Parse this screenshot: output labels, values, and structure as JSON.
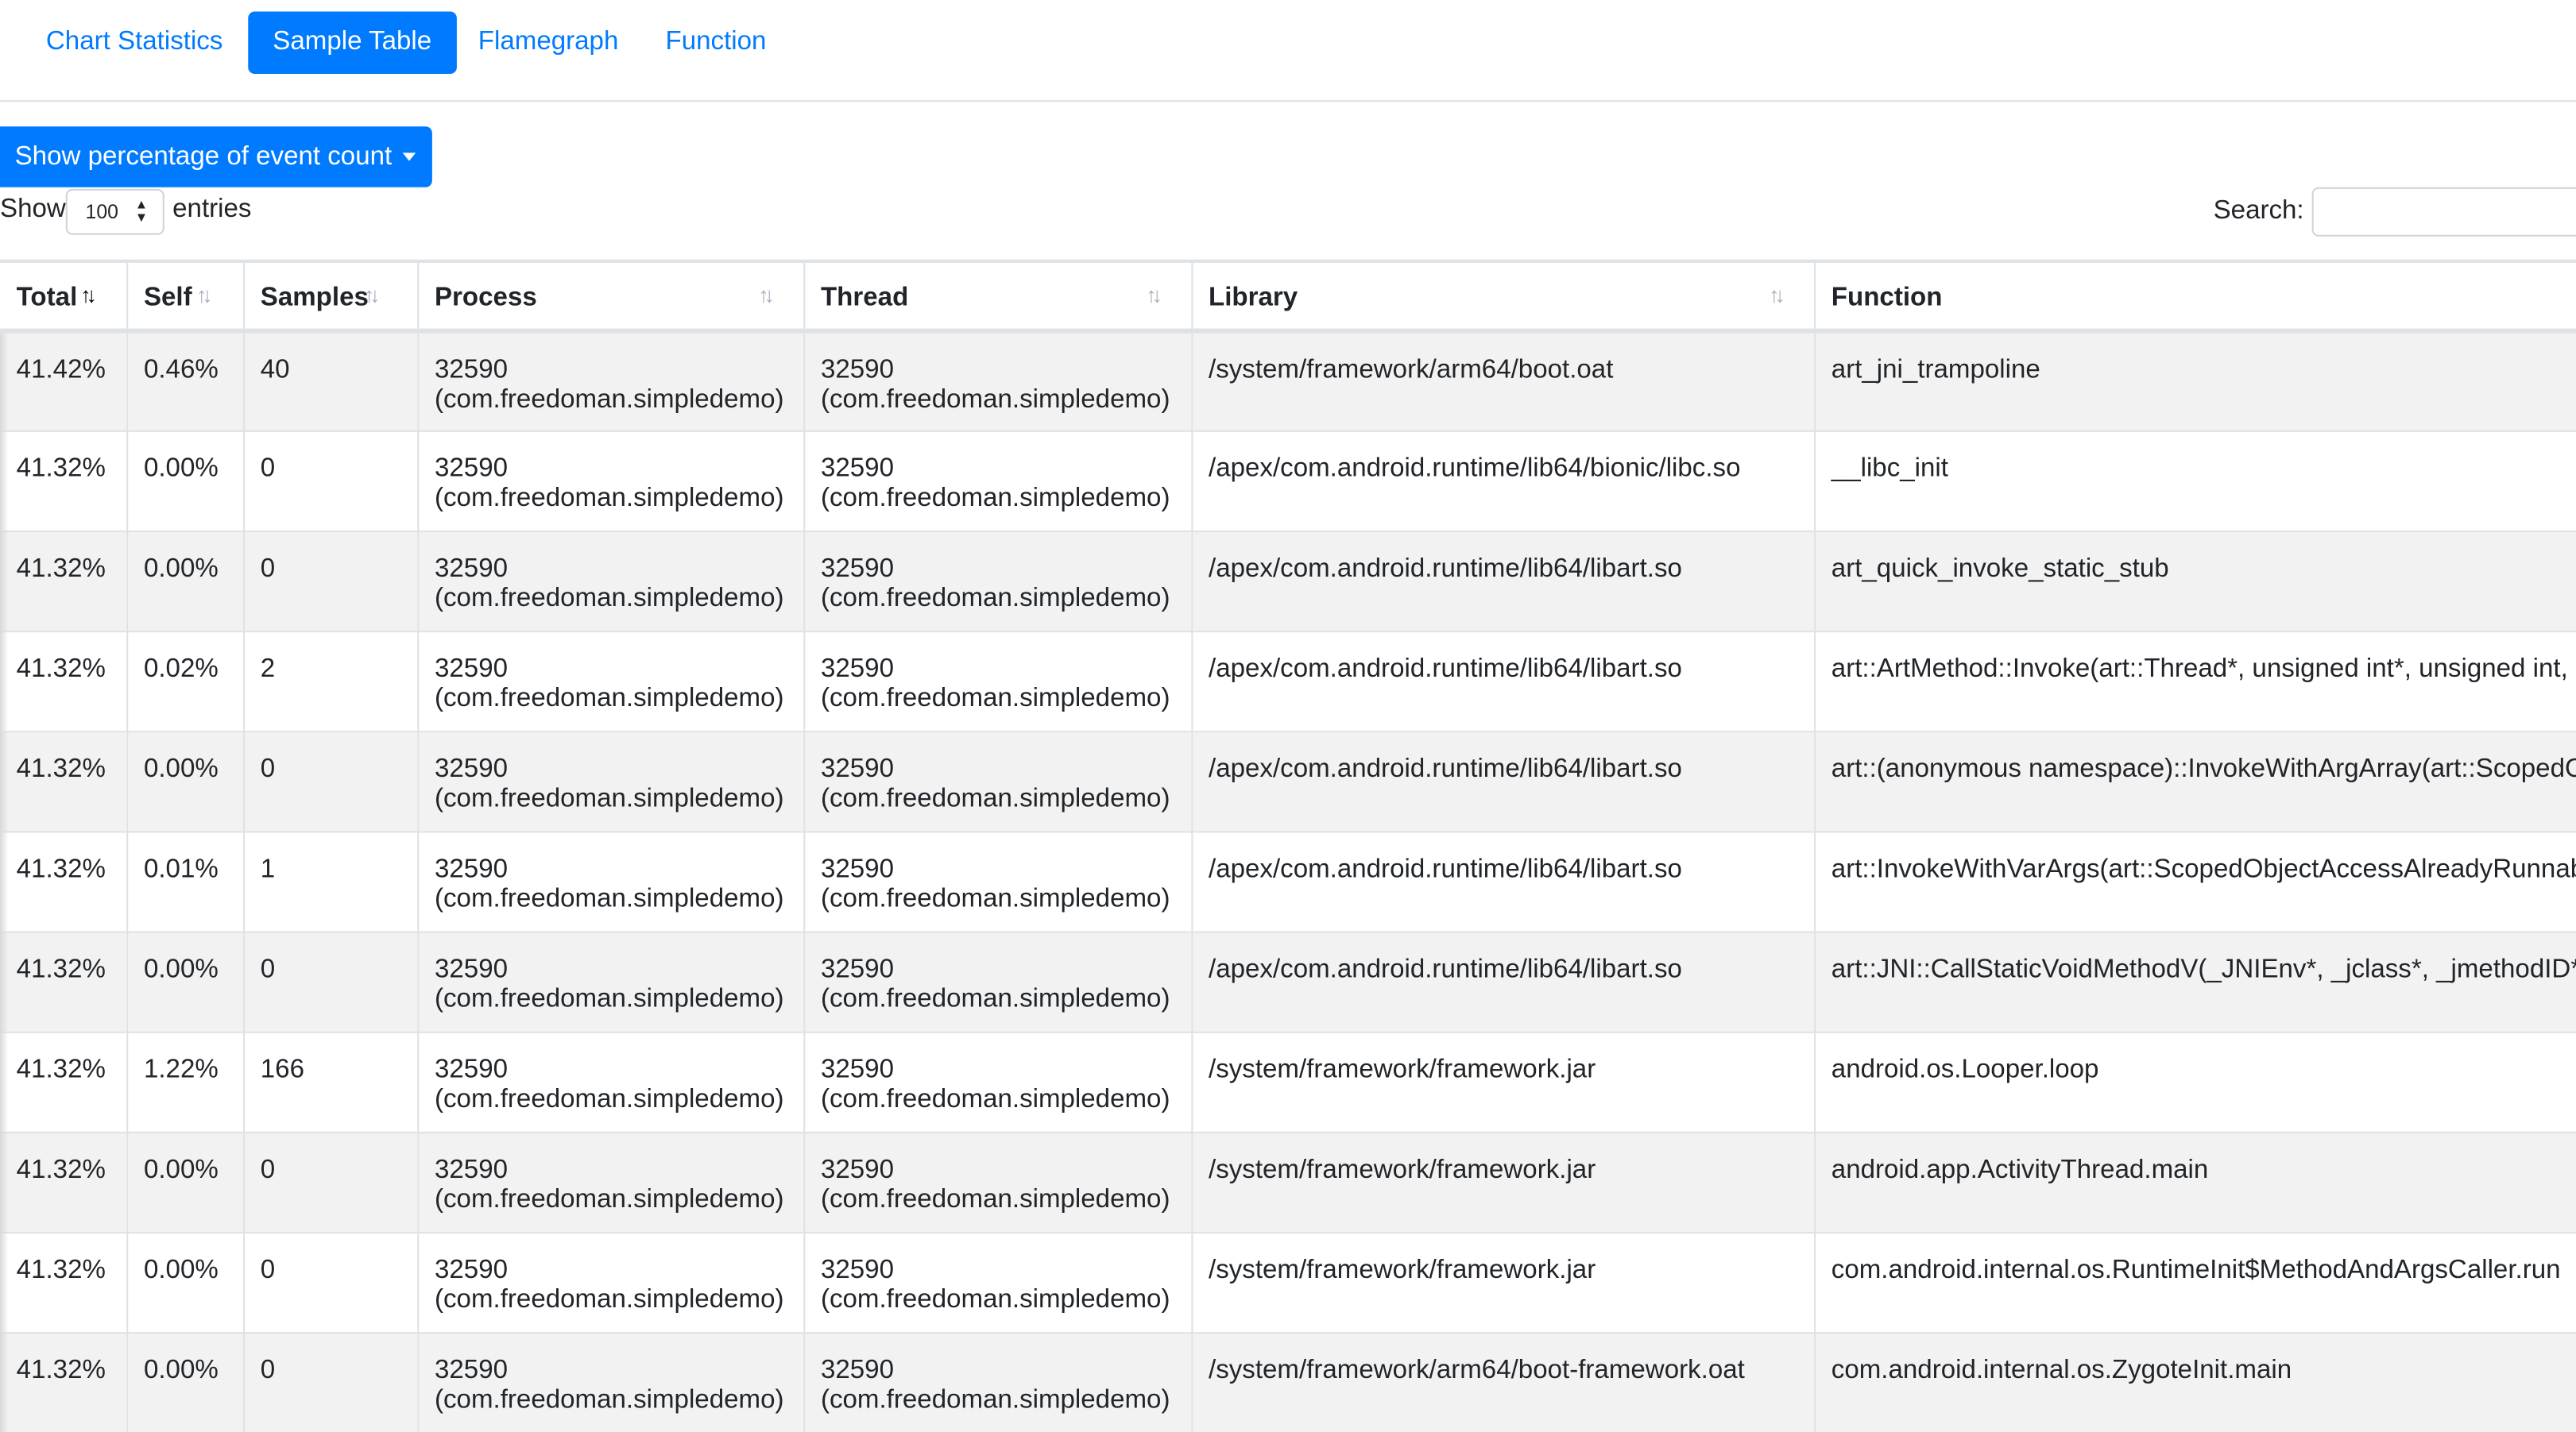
{
  "tabs": [
    {
      "label": "Chart Statistics"
    },
    {
      "label": "Sample Table"
    },
    {
      "label": "Flamegraph"
    },
    {
      "label": "Function"
    }
  ],
  "dropdown_label": "Show percentage of event count",
  "length": {
    "show_label": "Show",
    "value": "100",
    "entries_label": "entries"
  },
  "search": {
    "label": "Search:",
    "value": ""
  },
  "columns": [
    "Total",
    "Self",
    "Samples",
    "Process",
    "Thread",
    "Library",
    "Function"
  ],
  "rows": [
    {
      "total": "41.42%",
      "self": "0.46%",
      "samples": "40",
      "process_id": "32590",
      "process_name": "(com.freedoman.simpledemo)",
      "thread_id": "32590",
      "thread_name": "(com.freedoman.simpledemo)",
      "library": "/system/framework/arm64/boot.oat",
      "function": "art_jni_trampoline"
    },
    {
      "total": "41.32%",
      "self": "0.00%",
      "samples": "0",
      "process_id": "32590",
      "process_name": "(com.freedoman.simpledemo)",
      "thread_id": "32590",
      "thread_name": "(com.freedoman.simpledemo)",
      "library": "/apex/com.android.runtime/lib64/bionic/libc.so",
      "function": "__libc_init"
    },
    {
      "total": "41.32%",
      "self": "0.00%",
      "samples": "0",
      "process_id": "32590",
      "process_name": "(com.freedoman.simpledemo)",
      "thread_id": "32590",
      "thread_name": "(com.freedoman.simpledemo)",
      "library": "/apex/com.android.runtime/lib64/libart.so",
      "function": "art_quick_invoke_static_stub"
    },
    {
      "total": "41.32%",
      "self": "0.02%",
      "samples": "2",
      "process_id": "32590",
      "process_name": "(com.freedoman.simpledemo)",
      "thread_id": "32590",
      "thread_name": "(com.freedoman.simpledemo)",
      "library": "/apex/com.android.runtime/lib64/libart.so",
      "function": "art::ArtMethod::Invoke(art::Thread*, unsigned int*, unsigned int, a"
    },
    {
      "total": "41.32%",
      "self": "0.00%",
      "samples": "0",
      "process_id": "32590",
      "process_name": "(com.freedoman.simpledemo)",
      "thread_id": "32590",
      "thread_name": "(com.freedoman.simpledemo)",
      "library": "/apex/com.android.runtime/lib64/libart.so",
      "function": "art::(anonymous namespace)::InvokeWithArgArray(art::ScopedO"
    },
    {
      "total": "41.32%",
      "self": "0.01%",
      "samples": "1",
      "process_id": "32590",
      "process_name": "(com.freedoman.simpledemo)",
      "thread_id": "32590",
      "thread_name": "(com.freedoman.simpledemo)",
      "library": "/apex/com.android.runtime/lib64/libart.so",
      "function": "art::InvokeWithVarArgs(art::ScopedObjectAccessAlreadyRunnabl"
    },
    {
      "total": "41.32%",
      "self": "0.00%",
      "samples": "0",
      "process_id": "32590",
      "process_name": "(com.freedoman.simpledemo)",
      "thread_id": "32590",
      "thread_name": "(com.freedoman.simpledemo)",
      "library": "/apex/com.android.runtime/lib64/libart.so",
      "function": "art::JNI::CallStaticVoidMethodV(_JNIEnv*, _jclass*, _jmethodID*,"
    },
    {
      "total": "41.32%",
      "self": "1.22%",
      "samples": "166",
      "process_id": "32590",
      "process_name": "(com.freedoman.simpledemo)",
      "thread_id": "32590",
      "thread_name": "(com.freedoman.simpledemo)",
      "library": "/system/framework/framework.jar",
      "function": "android.os.Looper.loop"
    },
    {
      "total": "41.32%",
      "self": "0.00%",
      "samples": "0",
      "process_id": "32590",
      "process_name": "(com.freedoman.simpledemo)",
      "thread_id": "32590",
      "thread_name": "(com.freedoman.simpledemo)",
      "library": "/system/framework/framework.jar",
      "function": "android.app.ActivityThread.main"
    },
    {
      "total": "41.32%",
      "self": "0.00%",
      "samples": "0",
      "process_id": "32590",
      "process_name": "(com.freedoman.simpledemo)",
      "thread_id": "32590",
      "thread_name": "(com.freedoman.simpledemo)",
      "library": "/system/framework/framework.jar",
      "function": "com.android.internal.os.RuntimeInit$MethodAndArgsCaller.run"
    },
    {
      "total": "41.32%",
      "self": "0.00%",
      "samples": "0",
      "process_id": "32590",
      "process_name": "(com.freedoman.simpledemo)",
      "thread_id": "32590",
      "thread_name": "(com.freedoman.simpledemo)",
      "library": "/system/framework/arm64/boot-framework.oat",
      "function": "com.android.internal.os.ZygoteInit.main"
    }
  ],
  "colors": {
    "accent": "#007bff",
    "stripe": "#f2f2f2",
    "border": "#dee2e6"
  },
  "icons": {
    "sort": "sort-arrows-icon",
    "sort_active": "sort-desc-icon"
  }
}
